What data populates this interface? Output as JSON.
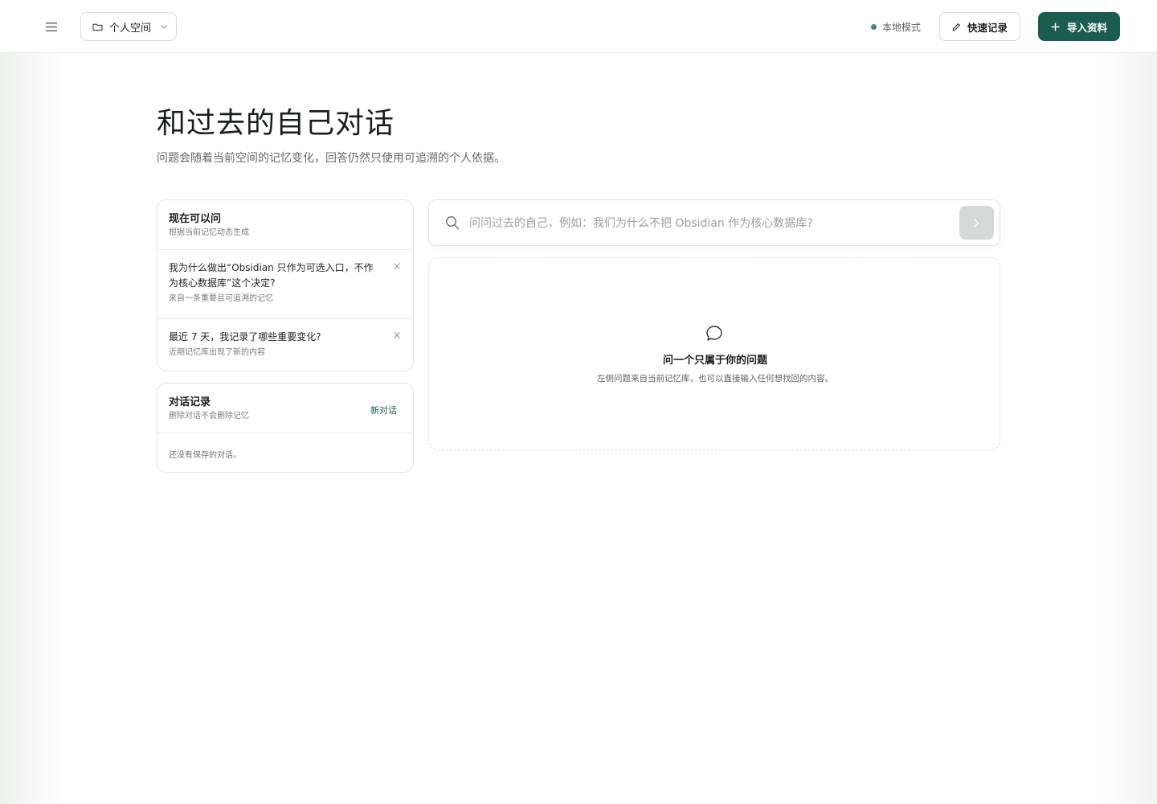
{
  "header": {
    "menu_icon": "hamburger-menu-icon",
    "space_selector": {
      "icon": "folder-icon",
      "value": "个人空间",
      "chevron": "chevron-down-icon"
    },
    "mode_status": "本地模式",
    "status_color": "#3f8a6a",
    "quick_note_label": "快速记录",
    "quick_note_icon": "pencil-icon",
    "import_label": "导入资料",
    "import_icon": "plus-icon",
    "accent_color": "#1a5c50"
  },
  "page": {
    "title": "和过去的自己对话",
    "subtitle": "问题会随着当前空间的记忆变化，回答仍然只使用可追溯的个人依据。"
  },
  "suggestions": {
    "title": "现在可以问",
    "subtitle": "根据当前记忆动态生成",
    "items": [
      {
        "question": "我为什么做出“Obsidian 只作为可选入口，不作为核心数据库”这个决定?",
        "source": "来自一条重要且可追溯的记忆"
      },
      {
        "question": "最近 7 天，我记录了哪些重要变化?",
        "source": "近期记忆库出现了新的内容"
      }
    ]
  },
  "history": {
    "title": "对话记录",
    "subtitle": "删除对话不会删除记忆",
    "new_chat_label": "新对话",
    "empty_text": "还没有保存的对话。"
  },
  "search": {
    "placeholder": "问问过去的自己，例如：我们为什么不把 Obsidian 作为核心数据库?",
    "value": "",
    "icon": "search-icon",
    "send_icon": "chevron-right-icon"
  },
  "empty_state": {
    "icon": "chat-bubble-icon",
    "title": "问一个只属于你的问题",
    "description": "左侧问题来自当前记忆库，也可以直接输入任何想找回的内容。"
  }
}
